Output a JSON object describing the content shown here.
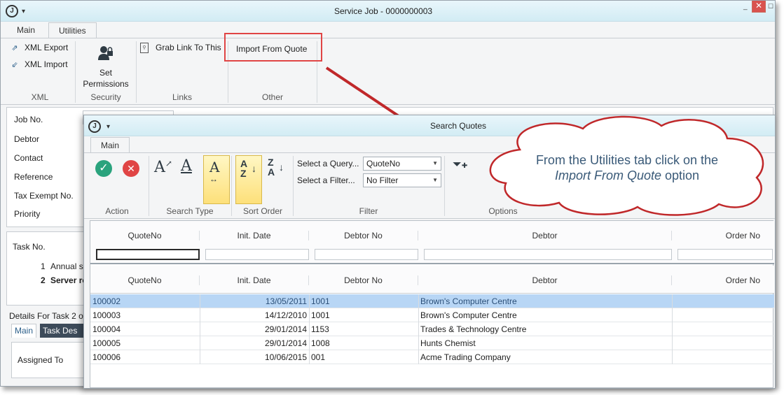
{
  "outer": {
    "logo": "J",
    "title": "Service Job - 0000000003",
    "window_controls": [
      "_",
      "☐",
      "✕"
    ],
    "tabs": [
      {
        "label": "Main"
      },
      {
        "label": "Utilities"
      }
    ],
    "ribbon": {
      "xml_group": {
        "export": "XML Export",
        "import": "XML Import",
        "label": "XML"
      },
      "security_group": {
        "button_line1": "Set",
        "button_line2": "Permissions",
        "label": "Security"
      },
      "links_group": {
        "button": "Grab Link To This",
        "label": "Links"
      },
      "other_group": {
        "button": "Import From Quote",
        "label": "Other"
      }
    },
    "form_labels": [
      "Job No.",
      "Debtor",
      "Contact",
      "Reference",
      "Tax Exempt No.",
      "Priority"
    ],
    "task_table": {
      "header": "Task No.",
      "rows": [
        {
          "num": "1",
          "text": "Annual se"
        },
        {
          "num": "2",
          "text": "Server re"
        }
      ]
    },
    "details": {
      "title": "Details For Task 2 o",
      "tabs": [
        "Main",
        "Task Des"
      ],
      "assigned_label": "Assigned To"
    }
  },
  "inner": {
    "logo": "J",
    "title": "Search Quotes",
    "tab": "Main",
    "groups": {
      "action": "Action",
      "search_type": "Search Type",
      "sort_order": "Sort Order",
      "filter": "Filter",
      "options": "Options"
    },
    "query_label": "Select a Query...",
    "query_value": "QuoteNo",
    "filter_label": "Select a Filter...",
    "filter_value": "No Filter",
    "columns": [
      "QuoteNo",
      "Init. Date",
      "Debtor No",
      "Debtor",
      "Order No"
    ],
    "rows": [
      {
        "quote": "100002",
        "date": "13/05/2011",
        "debtor_no": "1001",
        "debtor": "Brown's Computer Centre"
      },
      {
        "quote": "100003",
        "date": "14/12/2010",
        "debtor_no": "1001",
        "debtor": "Brown's Computer Centre"
      },
      {
        "quote": "100004",
        "date": "29/01/2014",
        "debtor_no": "1153",
        "debtor": "Trades & Technology Centre"
      },
      {
        "quote": "100005",
        "date": "29/01/2014",
        "debtor_no": "1008",
        "debtor": "Hunts Chemist"
      },
      {
        "quote": "100006",
        "date": "10/06/2015",
        "debtor_no": "001",
        "debtor": "Acme Trading Company"
      }
    ]
  },
  "callout": {
    "line1": "From the Utilities tab click on the",
    "line2_italic": "Import From Quote",
    "line2_rest": " option"
  },
  "colors": {
    "highlight_box": "#e04545",
    "arrow": "#c0282a",
    "selected_row": "#b8d6f5",
    "title_bar": "#d2ecf4",
    "callout_text": "#3a5a78"
  }
}
